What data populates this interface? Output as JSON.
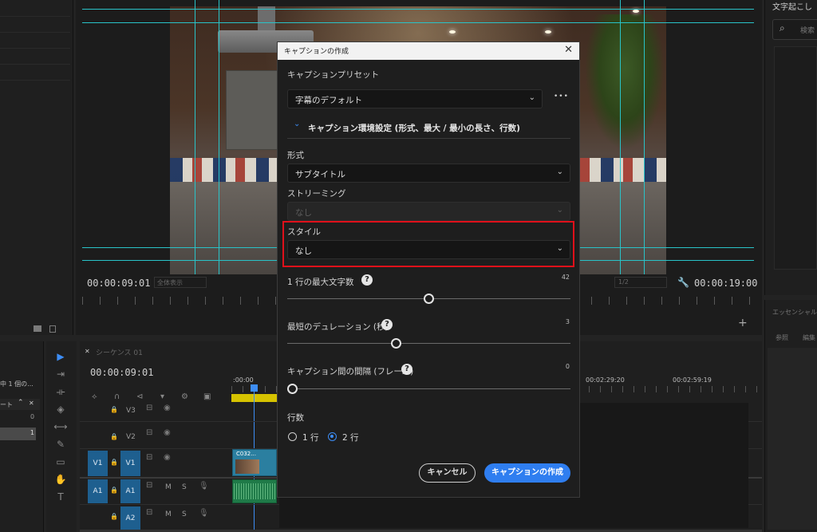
{
  "preview": {
    "timecode_left": "00:00:09:01",
    "fit_label": "全体表示",
    "quality_label": "1/2",
    "timecode_right": "00:00:19:00"
  },
  "right_panel": {
    "title": "文字起こし",
    "search_placeholder": "検索",
    "essential_graphics_title": "エッセンシャル",
    "tab_browse": "参照",
    "tab_edit": "編集"
  },
  "left_panel": {
    "status_text": "中 1 個の...",
    "column_label": "ート",
    "count": "0",
    "row_value": "1"
  },
  "timeline": {
    "sequence_name": "シーケンス 01",
    "timecode": "00:00:09:01",
    "ruler_labels": [
      ":00:00",
      "00:02:29:20",
      "00:02:59:19"
    ],
    "tracks": {
      "v3": "V3",
      "v2": "V2",
      "v1_source": "V1",
      "v1": "V1",
      "a1_source": "A1",
      "a1": "A1",
      "a2": "A2",
      "m": "M",
      "s": "S"
    },
    "clip_label": "C032..."
  },
  "dialog": {
    "title": "キャプションの作成",
    "preset_label": "キャプションプリセット",
    "preset_value": "字幕のデフォルト",
    "more_label": "•••",
    "section_title": "キャプション環境設定",
    "section_subtitle": "(形式、最大 / 最小の長さ、行数)",
    "format_label": "形式",
    "format_value": "サブタイトル",
    "streaming_label": "ストリーミング",
    "streaming_value": "なし",
    "style_label": "スタイル",
    "style_value": "なし",
    "max_chars_label": "1 行の最大文字数",
    "max_chars_value": "42",
    "max_chars_fraction": 0.5,
    "min_duration_label": "最短のデュレーション (秒)",
    "min_duration_value": "3",
    "min_duration_fraction": 0.38,
    "gap_label": "キャプション間の間隔 (フレーム)",
    "gap_value": "0",
    "gap_fraction": 0.0,
    "lines_label": "行数",
    "line_option_1": "1 行",
    "line_option_2": "2 行",
    "selected_lines": 2,
    "cancel_label": "キャンセル",
    "create_label": "キャプションの作成"
  },
  "colors": {
    "accent": "#2f7ef0",
    "highlight": "#e0101a",
    "guide": "#29c3c8",
    "track_blue": "#1e5f8f"
  }
}
